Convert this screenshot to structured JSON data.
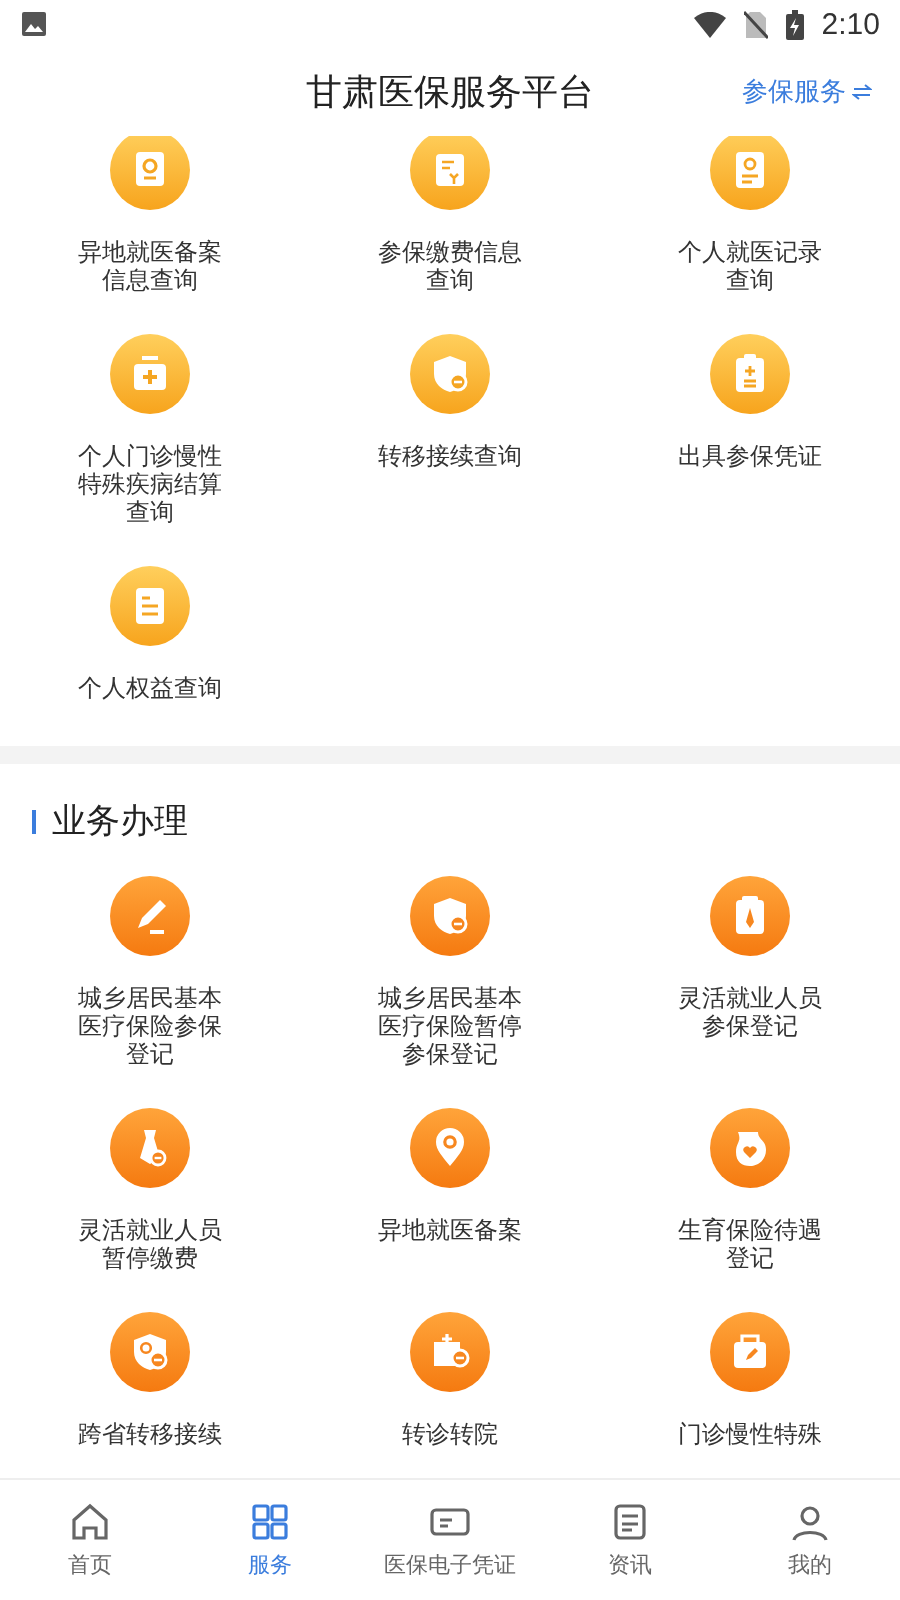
{
  "status_bar": {
    "time": "2:10"
  },
  "header": {
    "title": "甘肃医保服务平台",
    "action": "参保服务"
  },
  "query_section": {
    "items": [
      {
        "label": "异地就医备案信息查询"
      },
      {
        "label": "参保缴费信息查询"
      },
      {
        "label": "个人就医记录查询"
      },
      {
        "label": "个人门诊慢性特殊疾病结算查询"
      },
      {
        "label": "转移接续查询"
      },
      {
        "label": "出具参保凭证"
      },
      {
        "label": "个人权益查询"
      }
    ]
  },
  "business_section": {
    "title": "业务办理",
    "items": [
      {
        "label": "城乡居民基本医疗保险参保登记"
      },
      {
        "label": "城乡居民基本医疗保险暂停参保登记"
      },
      {
        "label": "灵活就业人员参保登记"
      },
      {
        "label": "灵活就业人员暂停缴费"
      },
      {
        "label": "异地就医备案"
      },
      {
        "label": "生育保险待遇登记"
      },
      {
        "label": "跨省转移接续"
      },
      {
        "label": "转诊转院"
      },
      {
        "label": "门诊慢性特殊"
      }
    ]
  },
  "bottom_nav": [
    {
      "label": "首页",
      "selected": false
    },
    {
      "label": "服务",
      "selected": true
    },
    {
      "label": "医保电子凭证",
      "selected": false
    },
    {
      "label": "资讯",
      "selected": false
    },
    {
      "label": "我的",
      "selected": false
    }
  ]
}
